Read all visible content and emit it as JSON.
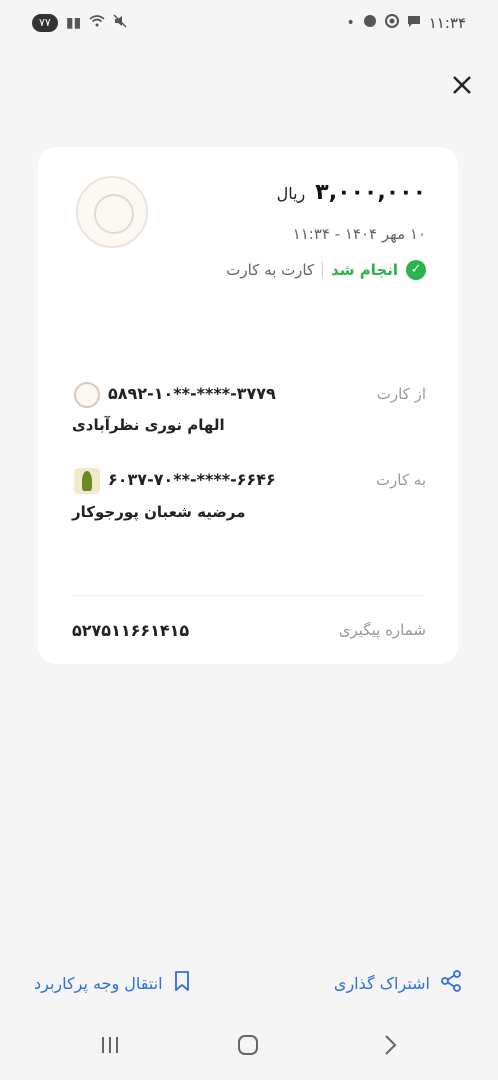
{
  "status_bar": {
    "battery": "۷۷",
    "time": "۱۱:۳۴"
  },
  "receipt": {
    "amount": "۳,۰۰۰,۰۰۰",
    "currency": "ریال",
    "datetime": "۱۰ مهر ۱۴۰۴ - ۱۱:۳۴",
    "status": "انجام شد",
    "type": "کارت به کارت",
    "from_label": "از کارت",
    "from_card": "۵۸۹۲-۱۰**-****-۳۷۷۹",
    "from_name": "الهام نوری نظرآبادی",
    "to_label": "به کارت",
    "to_card": "۶۰۳۷-۷۰**-****-۶۶۴۶",
    "to_name": "مرضیه  شعبان پورجوکار",
    "tracking_label": "شماره پیگیری",
    "tracking_number": "۵۲۷۵۱۱۶۶۱۴۱۵"
  },
  "actions": {
    "share": "اشتراک گذاری",
    "transfer": "انتقال وجه پرکاربرد"
  },
  "colors": {
    "accent": "#2d6fe3",
    "success": "#2cb34a"
  }
}
